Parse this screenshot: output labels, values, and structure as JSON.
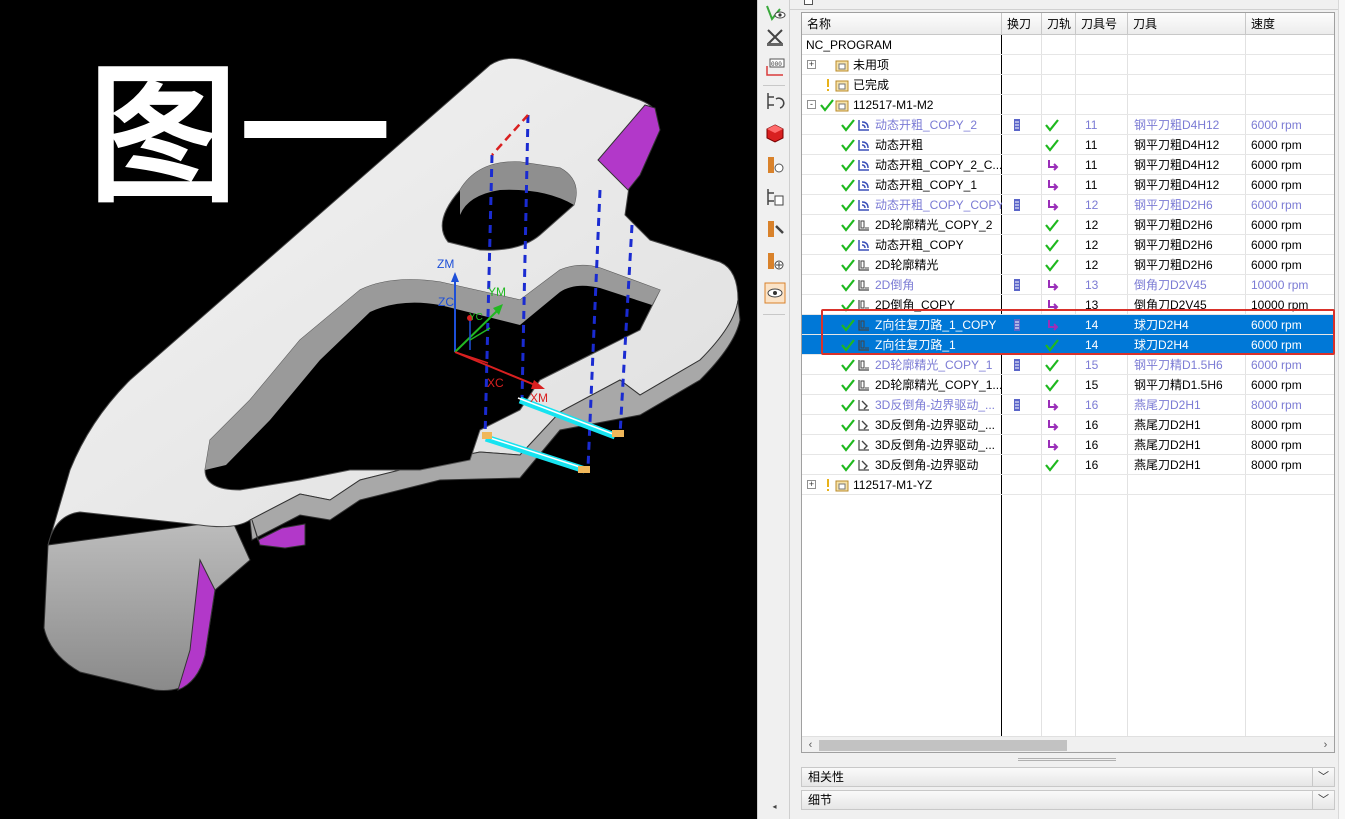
{
  "viewport": {
    "caption": "图一",
    "axes": {
      "zm": "ZM",
      "zc": "ZC",
      "ym": "YM",
      "yc": "YC",
      "xc": "XC",
      "xm": "XM"
    }
  },
  "toolbar": {
    "icons": [
      "eye-icon",
      "machine-tool-icon",
      "operation-navigator-icon",
      "program-order-icon",
      "part-navigator-icon",
      "tool-view-icon",
      "geometry-view-icon",
      "method-view-icon",
      "machine-view-icon",
      "visibility-icon"
    ]
  },
  "navigator": {
    "columns": {
      "name": "名称",
      "tool_change": "换刀",
      "toolpath": "刀轨",
      "tool_number": "刀具号",
      "tool": "刀具",
      "speed": "速度"
    },
    "rows": [
      {
        "name": "NC_PROGRAM",
        "level": 0,
        "kind": "root"
      },
      {
        "name": "未用项",
        "level": 1,
        "kind": "group",
        "expander": "+"
      },
      {
        "name": "已完成",
        "level": 1,
        "kind": "group-warn"
      },
      {
        "name": "112517-M1-M2",
        "level": 1,
        "kind": "group-ok",
        "expander": "-"
      },
      {
        "name": "动态开粗_COPY_2",
        "op": "cavity",
        "tc": true,
        "tp": "check",
        "tno": "11",
        "tool": "钢平刀粗D4H12",
        "speed": "6000 rpm",
        "style": "blue"
      },
      {
        "name": "动态开粗",
        "op": "cavity",
        "tc": false,
        "tp": "check",
        "tno": "11",
        "tool": "钢平刀粗D4H12",
        "speed": "6000 rpm",
        "style": "normal"
      },
      {
        "name": "动态开粗_COPY_2_C...",
        "op": "cavity",
        "tc": false,
        "tp": "arrow",
        "tno": "11",
        "tool": "钢平刀粗D4H12",
        "speed": "6000 rpm",
        "style": "normal"
      },
      {
        "name": "动态开粗_COPY_1",
        "op": "cavity",
        "tc": false,
        "tp": "arrow",
        "tno": "11",
        "tool": "钢平刀粗D4H12",
        "speed": "6000 rpm",
        "style": "normal"
      },
      {
        "name": "动态开粗_COPY_COPY",
        "op": "cavity",
        "tc": true,
        "tp": "arrow",
        "tno": "12",
        "tool": "钢平刀粗D2H6",
        "speed": "6000 rpm",
        "style": "blue"
      },
      {
        "name": "2D轮廓精光_COPY_2",
        "op": "planar",
        "tc": false,
        "tp": "check",
        "tno": "12",
        "tool": "钢平刀粗D2H6",
        "speed": "6000 rpm",
        "style": "normal"
      },
      {
        "name": "动态开粗_COPY",
        "op": "cavity",
        "tc": false,
        "tp": "check",
        "tno": "12",
        "tool": "钢平刀粗D2H6",
        "speed": "6000 rpm",
        "style": "normal"
      },
      {
        "name": "2D轮廓精光",
        "op": "planar",
        "tc": false,
        "tp": "check",
        "tno": "12",
        "tool": "钢平刀粗D2H6",
        "speed": "6000 rpm",
        "style": "normal"
      },
      {
        "name": "2D倒角",
        "op": "planar",
        "tc": true,
        "tp": "arrow",
        "tno": "13",
        "tool": "倒角刀D2V45",
        "speed": "10000 rpm",
        "style": "blue"
      },
      {
        "name": "2D倒角_COPY",
        "op": "planar",
        "tc": false,
        "tp": "arrow",
        "tno": "13",
        "tool": "倒角刀D2V45",
        "speed": "10000 rpm",
        "style": "normal"
      },
      {
        "name": "Z向往复刀路_1_COPY",
        "op": "planar",
        "tc": true,
        "tp": "arrow",
        "tno": "14",
        "tool": "球刀D2H4",
        "speed": "6000 rpm",
        "style": "selected"
      },
      {
        "name": "Z向往复刀路_1",
        "op": "planar",
        "tc": false,
        "tp": "check",
        "tno": "14",
        "tool": "球刀D2H4",
        "speed": "6000 rpm",
        "style": "selected"
      },
      {
        "name": "2D轮廓精光_COPY_1",
        "op": "planar",
        "tc": true,
        "tp": "check",
        "tno": "15",
        "tool": "钢平刀精D1.5H6",
        "speed": "6000 rpm",
        "style": "blue"
      },
      {
        "name": "2D轮廓精光_COPY_1...",
        "op": "planar",
        "tc": false,
        "tp": "check",
        "tno": "15",
        "tool": "钢平刀精D1.5H6",
        "speed": "6000 rpm",
        "style": "normal"
      },
      {
        "name": "3D反倒角-边界驱动_...",
        "op": "contour",
        "tc": true,
        "tp": "arrow",
        "tno": "16",
        "tool": "燕尾刀D2H1",
        "speed": "8000 rpm",
        "style": "blue"
      },
      {
        "name": "3D反倒角-边界驱动_...",
        "op": "contour",
        "tc": false,
        "tp": "arrow",
        "tno": "16",
        "tool": "燕尾刀D2H1",
        "speed": "8000 rpm",
        "style": "normal"
      },
      {
        "name": "3D反倒角-边界驱动_...",
        "op": "contour",
        "tc": false,
        "tp": "arrow",
        "tno": "16",
        "tool": "燕尾刀D2H1",
        "speed": "8000 rpm",
        "style": "normal"
      },
      {
        "name": "3D反倒角-边界驱动",
        "op": "contour",
        "tc": false,
        "tp": "check",
        "tno": "16",
        "tool": "燕尾刀D2H1",
        "speed": "8000 rpm",
        "style": "normal"
      },
      {
        "name": "112517-M1-YZ",
        "level": 1,
        "kind": "group-warn",
        "expander": "+"
      }
    ],
    "sections": {
      "dependencies": "相关性",
      "details": "细节"
    }
  },
  "colors": {
    "selection": "#0078d7",
    "highlight_box": "#d9312a",
    "check": "#1fb81f",
    "arrow": "#9a2fb8",
    "blue_text": "#7b7bd4"
  }
}
